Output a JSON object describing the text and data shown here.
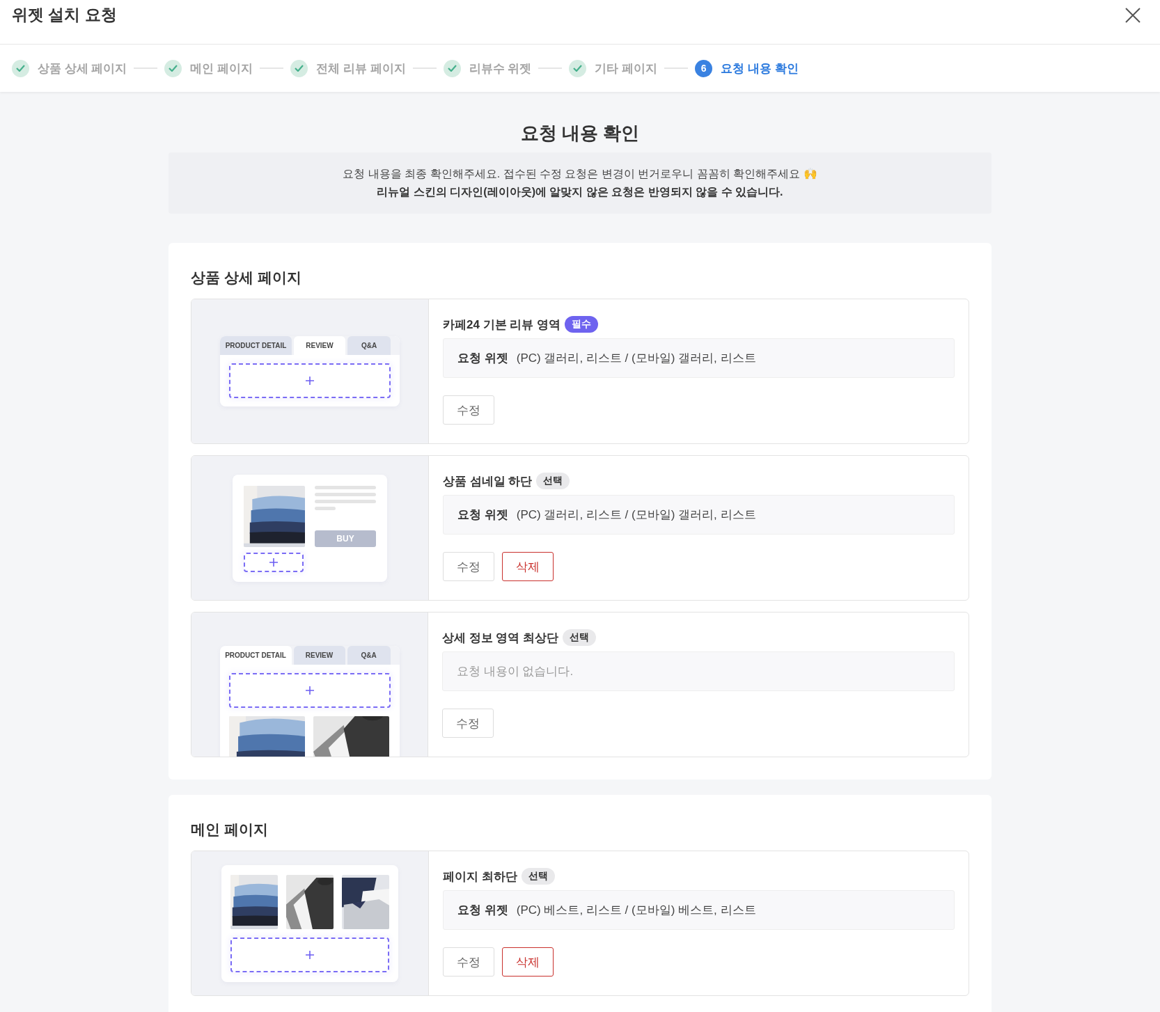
{
  "header": {
    "title": "위젯 설치 요청"
  },
  "steps": [
    {
      "label": "상품 상세 페이지",
      "done": true,
      "selected": false
    },
    {
      "label": "메인 페이지",
      "done": true,
      "selected": false
    },
    {
      "label": "전체 리뷰 페이지",
      "done": true,
      "selected": false
    },
    {
      "label": "리뷰수 위젯",
      "done": true,
      "selected": false
    },
    {
      "label": "기타 페이지",
      "done": true,
      "selected": false
    },
    {
      "label": "요청 내용 확인",
      "done": false,
      "selected": true,
      "number": "6"
    }
  ],
  "page_title": "요청 내용 확인",
  "notice": {
    "text": "요청 내용을 최종 확인해주세요. 접수된 수정 요청은 변경이 번거로우니 꼼꼼히 확인해주세요 🙌",
    "emphasis": "리뉴얼 스킨의 디자인(레이아웃)에 알맞지 않은 요청은 반영되지 않을 수 있습니다."
  },
  "sections": [
    {
      "title": "상품 상세 페이지",
      "items": [
        {
          "illustration": {
            "kind": "tabs",
            "tabs": [
              {
                "label": "PRODUCT DETAIL",
                "selected": false
              },
              {
                "label": "REVIEW",
                "selected": true
              },
              {
                "label": "Q&A",
                "selected": false
              }
            ]
          },
          "title": "카페24 기본 리뷰 영역",
          "badge": {
            "label": "필수",
            "kind": "required"
          },
          "request": {
            "label": "요청 위젯",
            "value": "(PC) 갤러리, 리스트 / (모바일) 갤러리, 리스트"
          },
          "buttons": [
            {
              "label": "수정",
              "kind": "edit"
            }
          ]
        },
        {
          "illustration": {
            "kind": "product",
            "button": "BUY"
          },
          "title": "상품 섬네일 하단",
          "badge": {
            "label": "선택",
            "kind": "optional"
          },
          "request": {
            "label": "요청 위젯",
            "value": "(PC) 갤러리, 리스트 / (모바일) 갤러리, 리스트"
          },
          "buttons": [
            {
              "label": "수정",
              "kind": "edit"
            },
            {
              "label": "삭제",
              "kind": "delete"
            }
          ]
        },
        {
          "illustration": {
            "kind": "tabs-gallery",
            "tabs": [
              {
                "label": "PRODUCT DETAIL",
                "selected": true
              },
              {
                "label": "REVIEW",
                "selected": false
              },
              {
                "label": "Q&A",
                "selected": false
              }
            ]
          },
          "title": "상세 정보 영역 최상단",
          "badge": {
            "label": "선택",
            "kind": "optional"
          },
          "request": {
            "empty_text": "요청 내용이 없습니다."
          },
          "buttons": [
            {
              "label": "수정",
              "kind": "edit"
            }
          ]
        }
      ]
    },
    {
      "title": "메인 페이지",
      "items": [
        {
          "illustration": {
            "kind": "gallery"
          },
          "title": "페이지 최하단",
          "badge": {
            "label": "선택",
            "kind": "optional"
          },
          "request": {
            "label": "요청 위젯",
            "value": "(PC) 베스트, 리스트 / (모바일) 베스트, 리스트"
          },
          "buttons": [
            {
              "label": "수정",
              "kind": "edit"
            },
            {
              "label": "삭제",
              "kind": "delete"
            }
          ]
        }
      ]
    }
  ]
}
